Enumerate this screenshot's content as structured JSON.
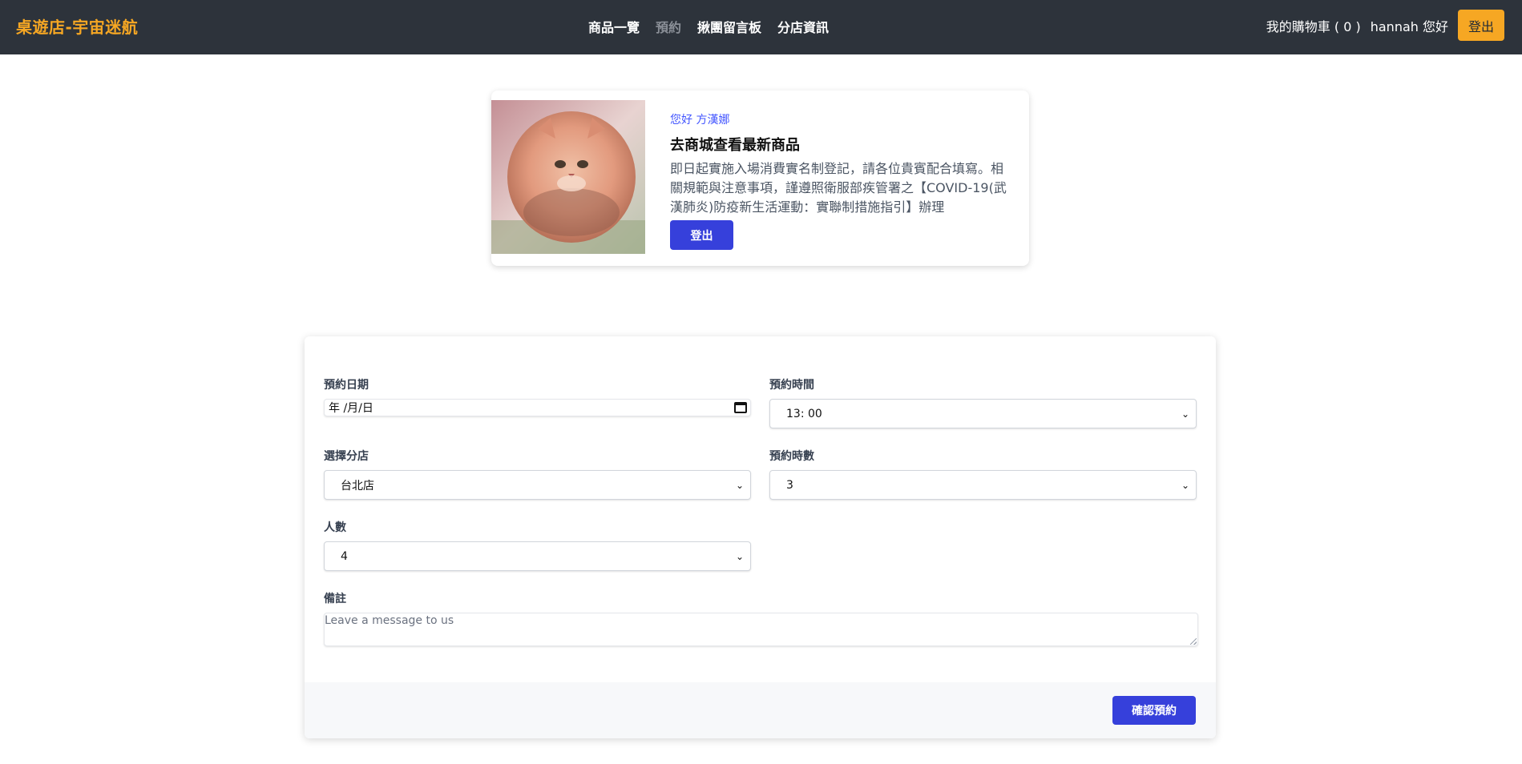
{
  "nav": {
    "brand": "桌遊店-宇宙迷航",
    "links": [
      "商品一覽",
      "預約",
      "揪團留言板",
      "分店資訊"
    ],
    "cart": "我的購物車 ( 0 )",
    "user_greeting": "hannah 您好",
    "logout": "登出"
  },
  "profile_card": {
    "greeting": "您好 方漢娜",
    "title": "去商城查看最新商品",
    "description": "即日起實施入場消費實名制登記，請各位貴賓配合填寫。相關規範與注意事項，謹遵照衛服部疾管署之【COVID-19(武漢肺炎)防疫新生活運動：實聯制措施指引】辦理",
    "logout": "登出"
  },
  "form": {
    "date_label": "預約日期",
    "date_value": "年 /月/日",
    "time_label": "預約時間",
    "time_value": "13: 00",
    "branch_label": "選擇分店",
    "branch_value": "台北店",
    "hours_label": "預約時數",
    "hours_value": "3",
    "people_label": "人數",
    "people_value": "4",
    "note_label": "備註",
    "note_placeholder": "Leave a message to us",
    "confirm": "確認預約"
  },
  "colors": {
    "navbar_bg": "#2d333b",
    "brand": "#f6a723",
    "primary": "#3640db",
    "greeting": "#4356ff"
  }
}
